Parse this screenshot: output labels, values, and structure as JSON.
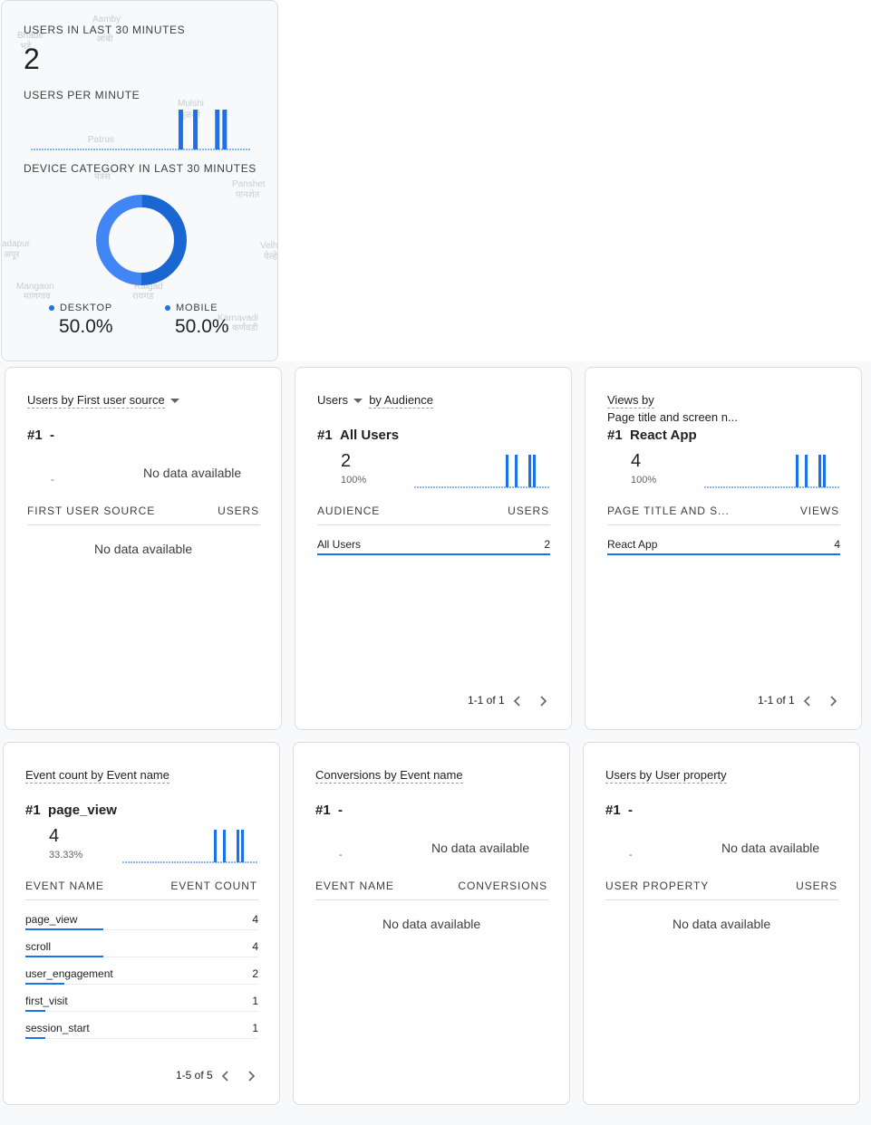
{
  "realtime": {
    "users_title": "USERS IN LAST 30 MINUTES",
    "users_value": "2",
    "per_minute_title": "USERS PER MINUTE",
    "per_minute_values": [
      0,
      0,
      0,
      0,
      0,
      0,
      0,
      0,
      0,
      0,
      0,
      0,
      0,
      0,
      0,
      0,
      0,
      0,
      0,
      0,
      1,
      0,
      1,
      0,
      0,
      1,
      1,
      0,
      0,
      0
    ],
    "device_title": "DEVICE CATEGORY IN LAST 30 MINUTES",
    "devices": [
      {
        "label": "DESKTOP",
        "value": "50.0%",
        "fraction": 0.5,
        "color": "#4285f4"
      },
      {
        "label": "MOBILE",
        "value": "50.0%",
        "fraction": 0.5,
        "color": "#1a66d2"
      }
    ],
    "map_labels": [
      "Aamby",
      "आंबी",
      "Bhade",
      "भडे",
      "Mulshi",
      "मुळशी",
      "Patrus",
      "पत्रस",
      "Panshet",
      "पानशेत",
      "Velha",
      "वेल्हे",
      "Mangaon",
      "माणगाव",
      "Raigad",
      "रायगड",
      "Karnavadi",
      "कर्णवडी",
      "adapur",
      "अपूर"
    ]
  },
  "cards": {
    "first_user_source": {
      "title": "Users by First user source",
      "rank_num": "#1",
      "rank_name": "-",
      "dash": "-",
      "nodata_top": "No data available",
      "col1": "FIRST USER SOURCE",
      "col2": "USERS",
      "nodata_table": "No data available"
    },
    "audience": {
      "title_metric": "Users",
      "title_dim": "by Audience",
      "rank_num": "#1",
      "rank_name": "All Users",
      "metric": "2",
      "pct": "100%",
      "spark": [
        0,
        0,
        0,
        0,
        0,
        0,
        0,
        0,
        0,
        0,
        0,
        0,
        0,
        0,
        0,
        0,
        0,
        0,
        0,
        0,
        1,
        0,
        1,
        0,
        0,
        1,
        1,
        0,
        0,
        0
      ],
      "col1": "AUDIENCE",
      "col2": "USERS",
      "rows": [
        {
          "label": "All Users",
          "value": "2",
          "fraction": 1.0
        }
      ],
      "pager": "1-1 of 1"
    },
    "views": {
      "title_line1": "Views by",
      "title_line2": "Page title and screen n...",
      "rank_num": "#1",
      "rank_name": "React App",
      "metric": "4",
      "pct": "100%",
      "spark": [
        0,
        0,
        0,
        0,
        0,
        0,
        0,
        0,
        0,
        0,
        0,
        0,
        0,
        0,
        0,
        0,
        0,
        0,
        0,
        0,
        1,
        0,
        1,
        0,
        0,
        1,
        1,
        0,
        0,
        0
      ],
      "col1": "PAGE TITLE AND S...",
      "col2": "VIEWS",
      "rows": [
        {
          "label": "React App",
          "value": "4",
          "fraction": 1.0
        }
      ],
      "pager": "1-1 of 1"
    },
    "event_count": {
      "title": "Event count by Event name",
      "rank_num": "#1",
      "rank_name": "page_view",
      "metric": "4",
      "pct": "33.33%",
      "spark": [
        0,
        0,
        0,
        0,
        0,
        0,
        0,
        0,
        0,
        0,
        0,
        0,
        0,
        0,
        0,
        0,
        0,
        0,
        0,
        0,
        1,
        0,
        1,
        0,
        0,
        1,
        1,
        0,
        0,
        0
      ],
      "col1": "EVENT NAME",
      "col2": "EVENT COUNT",
      "rows": [
        {
          "label": "page_view",
          "value": "4",
          "fraction": 1.0
        },
        {
          "label": "scroll",
          "value": "4",
          "fraction": 1.0
        },
        {
          "label": "user_engagement",
          "value": "2",
          "fraction": 0.5
        },
        {
          "label": "first_visit",
          "value": "1",
          "fraction": 0.25
        },
        {
          "label": "session_start",
          "value": "1",
          "fraction": 0.25
        }
      ],
      "pager": "1-5 of 5"
    },
    "conversions": {
      "title": "Conversions by Event name",
      "rank_num": "#1",
      "rank_name": "-",
      "dash": "-",
      "nodata_top": "No data available",
      "col1": "EVENT NAME",
      "col2": "CONVERSIONS",
      "nodata_table": "No data available"
    },
    "user_property": {
      "title": "Users by User property",
      "rank_num": "#1",
      "rank_name": "-",
      "dash": "-",
      "nodata_top": "No data available",
      "col1": "USER PROPERTY",
      "col2": "USERS",
      "nodata_table": "No data available"
    }
  },
  "colors": {
    "accent": "#1a73e8",
    "border": "#dadce0",
    "dashed": "#1a73e8"
  }
}
